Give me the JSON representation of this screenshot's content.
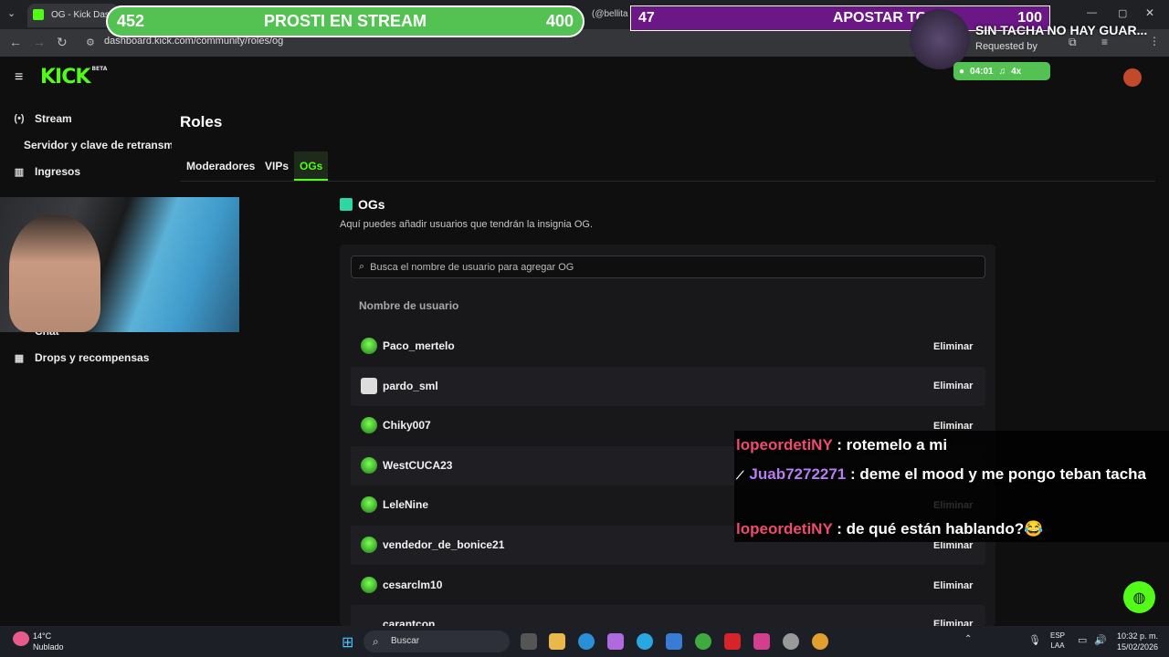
{
  "browser": {
    "tab_title": "OG - Kick Dashb",
    "tab2_title": "(@bellita",
    "url": "dashboard.kick.com/community/roles/og"
  },
  "sidebar": {
    "items": [
      {
        "label": "Stream",
        "icon": "broadcast-icon"
      },
      {
        "label": "Servidor y clave de retransm"
      },
      {
        "label": "Ingresos",
        "icon": "chart-icon"
      },
      {
        "label": "Chat"
      },
      {
        "label": "Drops y recompensas",
        "icon": "gift-icon"
      }
    ]
  },
  "logo": {
    "text": "KICK",
    "beta": "BETA"
  },
  "main": {
    "title": "Roles",
    "tabs": [
      "Moderadores",
      "VIPs",
      "OGs"
    ],
    "og_title": "OGs",
    "og_desc": "Aquí puedes añadir usuarios que tendrán la insignia OG.",
    "search_placeholder": "Busca el nombre de usuario para agregar OG",
    "column_header": "Nombre de usuario",
    "remove_label": "Eliminar",
    "users": [
      "Paco_mertelo",
      "pardo_sml",
      "Chiky007",
      "WestCUCA23",
      "LeleNine",
      "vendedor_de_bonice21",
      "cesarclm10",
      "carantcon"
    ]
  },
  "overlay": {
    "bar_left": {
      "left": "452",
      "label": "PROSTI EN STREAM",
      "right": "400"
    },
    "bar_right": {
      "left": "47",
      "label": "APOSTAR TODO",
      "right": "100"
    },
    "song_title": "SIN TACHA NO HAY GUAR...",
    "requested_by": "Requested by",
    "song_time": "04:01",
    "song_mult": "4x",
    "chat": [
      {
        "user": "lopeordetiNY",
        "sep": " : ",
        "msg": "rotemelo a mi"
      },
      {
        "user": "Juab7272271",
        "sep": " : ",
        "msg": "deme el mood y me pongo teban tacha"
      },
      {
        "user": "lopeordetiNY",
        "sep": " : ",
        "msg": "de qué están hablando?😂"
      }
    ]
  },
  "taskbar": {
    "temp": "14°C",
    "weather": "Nublado",
    "search": "Buscar",
    "lang1": "ESP",
    "lang2": "LAA",
    "time": "10:32 p. m.",
    "date": "15/02/2026"
  },
  "colors": {
    "accent": "#53fc18",
    "bar_green": "#54c253",
    "bar_purple": "#6b1786"
  }
}
